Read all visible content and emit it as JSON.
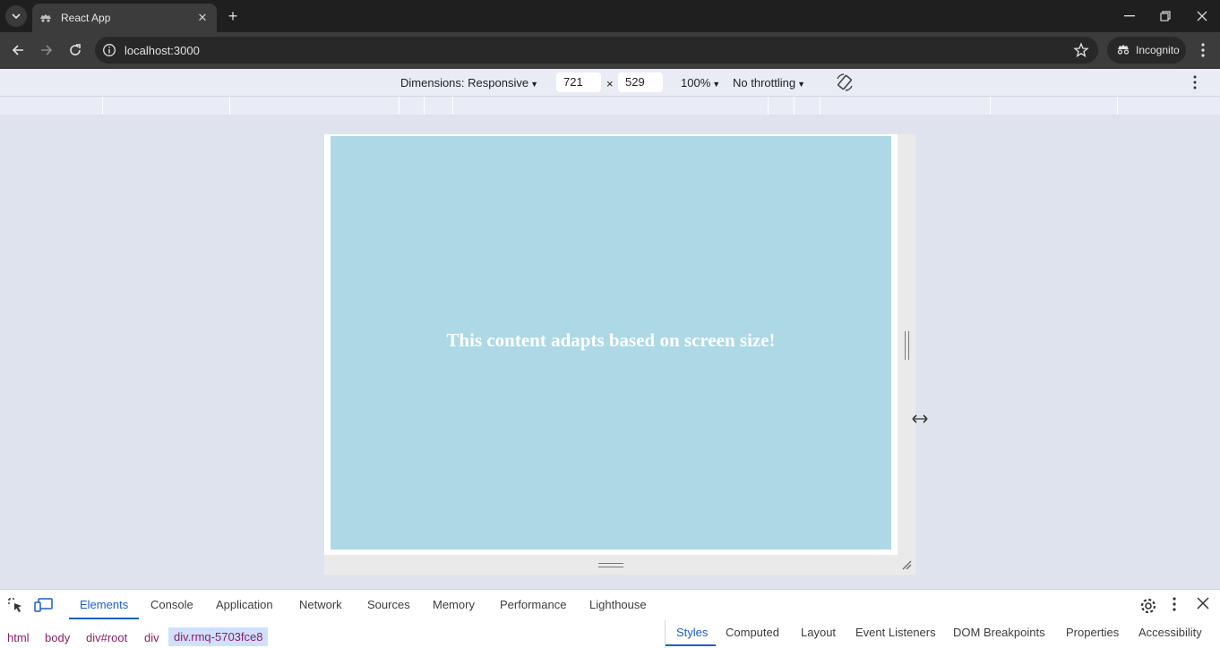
{
  "browser": {
    "tab_title": "React App",
    "url": "localhost:3000",
    "profile_label": "Incognito"
  },
  "device_toolbar": {
    "dimensions_label": "Dimensions: Responsive",
    "width": "721",
    "times": "×",
    "height": "529",
    "zoom": "100%",
    "throttling": "No throttling"
  },
  "app": {
    "heading": "This content adapts based on screen size!",
    "background_color": "#add8e6"
  },
  "devtools": {
    "tabs": [
      "Elements",
      "Console",
      "Application",
      "Network",
      "Sources",
      "Memory",
      "Performance",
      "Lighthouse"
    ],
    "active_tab": "Elements",
    "breadcrumbs": [
      "html",
      "body",
      "div#root",
      "div",
      "div.rmq-5703fce8"
    ],
    "side_tabs": [
      "Styles",
      "Computed",
      "Layout",
      "Event Listeners",
      "DOM Breakpoints",
      "Properties",
      "Accessibility"
    ],
    "active_side_tab": "Styles"
  },
  "colors": {
    "accent": "#1a5fc9",
    "chrome_dark": "#1f1f1f",
    "breadcrumb_text": "#8a1e63"
  }
}
